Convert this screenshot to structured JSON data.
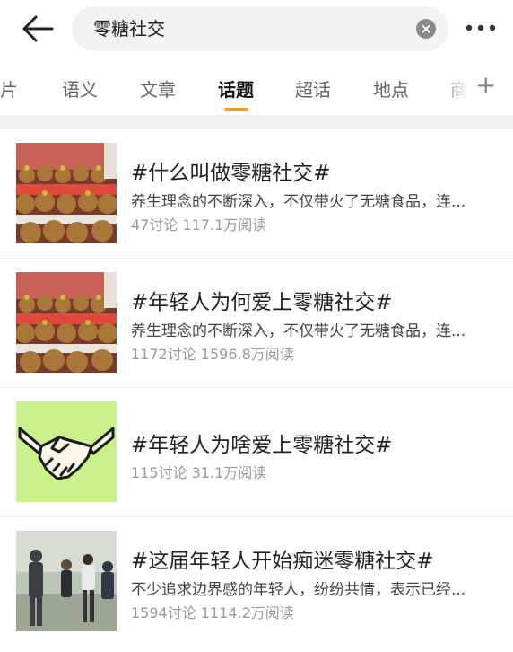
{
  "search": {
    "query": "零糖社交"
  },
  "tabs": [
    {
      "label": "图片"
    },
    {
      "label": "语义"
    },
    {
      "label": "文章"
    },
    {
      "label": "话题"
    },
    {
      "label": "超话"
    },
    {
      "label": "地点"
    },
    {
      "label": "商"
    }
  ],
  "tab_add_label": "+",
  "topics": [
    {
      "title": "#什么叫做零糖社交#",
      "desc": "养生理念的不断深入，不仅带火了无糖食品，连...",
      "stats": "47讨论 117.1万阅读",
      "thumb": "plush-toys"
    },
    {
      "title": "#年轻人为何爱上零糖社交#",
      "desc": "养生理念的不断深入，不仅带火了无糖食品，连...",
      "stats": "1172讨论 1596.8万阅读",
      "thumb": "plush-toys"
    },
    {
      "title": "#年轻人为啥爱上零糖社交#",
      "desc": "",
      "stats": "115讨论 31.1万阅读",
      "thumb": "handshake"
    },
    {
      "title": "#这届年轻人开始痴迷零糖社交#",
      "desc": "不少追求边界感的年轻人，纷纷共情，表示已经...",
      "stats": "1594讨论 1114.2万阅读",
      "thumb": "people-photo"
    }
  ],
  "colors": {
    "accent": "#f29b1d",
    "handshake_bg": "#c9f08a"
  }
}
